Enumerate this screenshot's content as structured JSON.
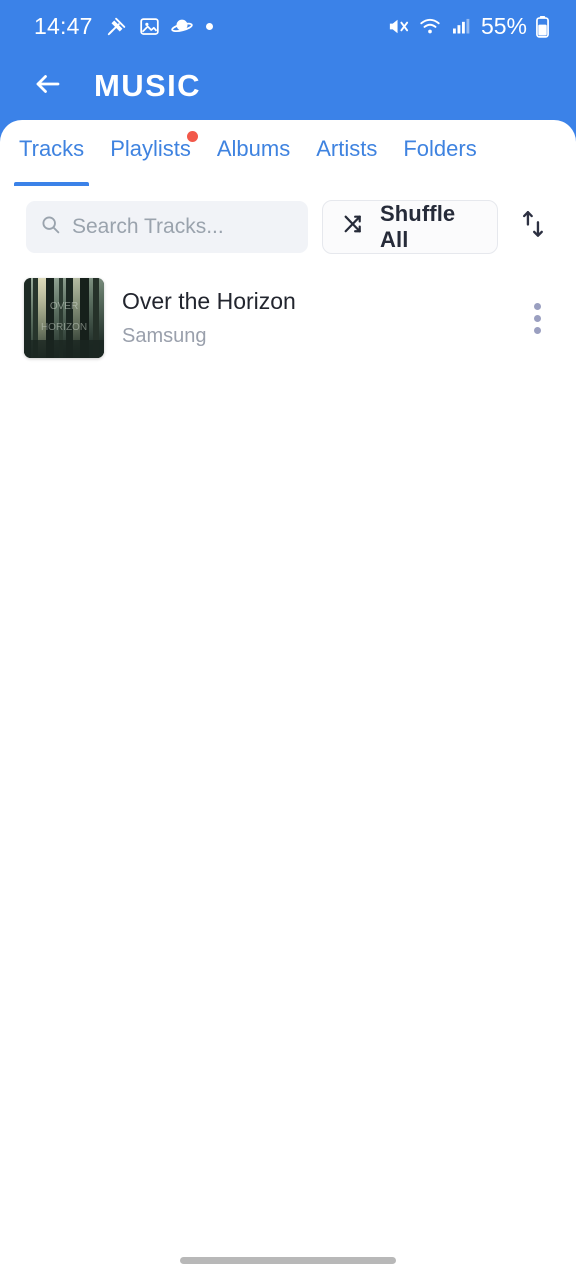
{
  "status_bar": {
    "time": "14:47",
    "left_icons": [
      "satellite-dish-icon",
      "image-icon",
      "saturn-icon",
      "dot-icon"
    ],
    "right_icons": [
      "mute-icon",
      "wifi-icon",
      "signal-icon"
    ],
    "battery_text": "55%",
    "battery_icon": "battery-icon"
  },
  "app_bar": {
    "back_icon": "back-arrow-icon",
    "title": "MUSIC"
  },
  "tabs": [
    {
      "label": "Tracks",
      "active": true,
      "badge": false
    },
    {
      "label": "Playlists",
      "active": false,
      "badge": true
    },
    {
      "label": "Albums",
      "active": false,
      "badge": false
    },
    {
      "label": "Artists",
      "active": false,
      "badge": false
    },
    {
      "label": "Folders",
      "active": false,
      "badge": false
    }
  ],
  "controls": {
    "search_icon": "search-icon",
    "search_value": "",
    "search_placeholder": "Search Tracks...",
    "shuffle_icon": "shuffle-icon",
    "shuffle_label": "Shuffle All",
    "sort_icon": "sort-arrows-icon"
  },
  "tracks": [
    {
      "title": "Over the Horizon",
      "artist": "Samsung",
      "artwork": "forest-album-art",
      "menu_icon": "more-vertical-icon"
    }
  ],
  "colors": {
    "header_blue": "#3b82e8",
    "tab_blue": "#3f83e0",
    "badge_red": "#f2584a",
    "title_text": "#22252e",
    "artist_text": "#9aa0ac",
    "search_bg": "#f1f3f7"
  },
  "navigation": {
    "gesture_bar": "home-gesture-bar"
  }
}
